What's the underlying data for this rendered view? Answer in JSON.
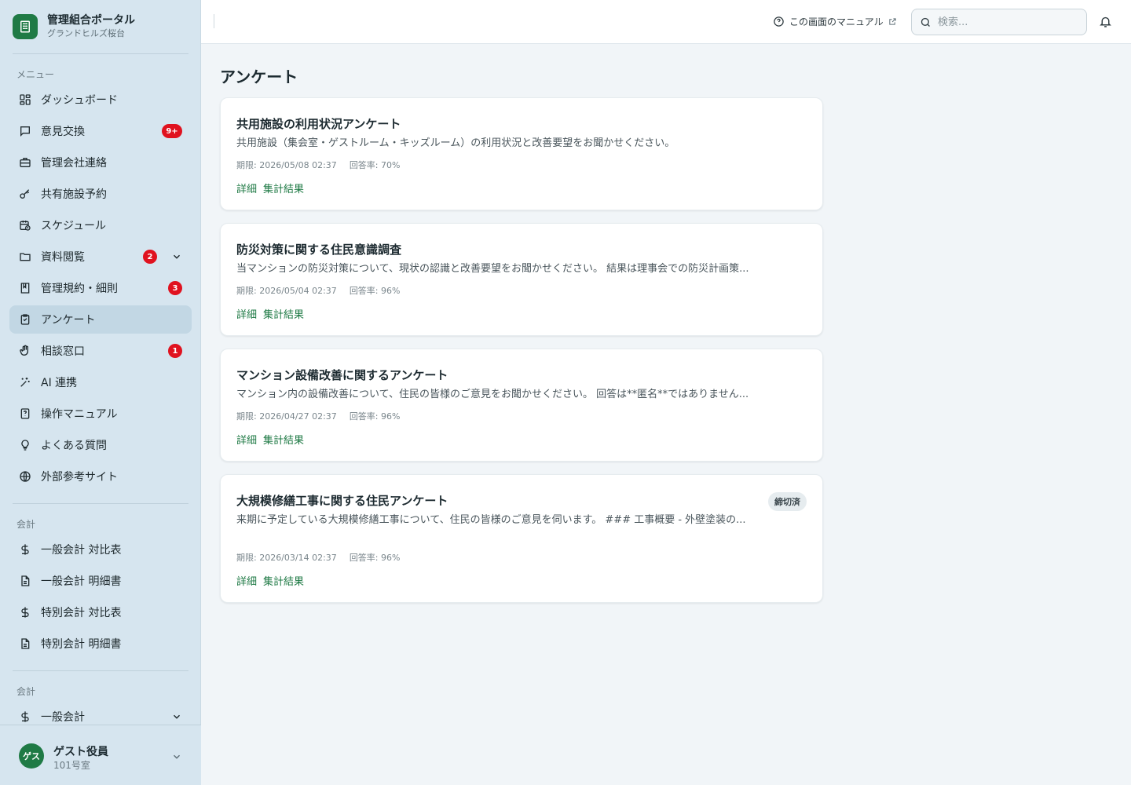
{
  "brand": {
    "title": "管理組合ポータル",
    "subtitle": "グランドヒルズ桜台"
  },
  "sidebar": {
    "menu_label": "メニュー",
    "items": [
      {
        "label": "ダッシュボード",
        "icon": "dashboard-icon"
      },
      {
        "label": "意見交換",
        "icon": "chat-icon",
        "badge": "9+"
      },
      {
        "label": "管理会社連絡",
        "icon": "briefcase-icon"
      },
      {
        "label": "共有施設予約",
        "icon": "key-icon"
      },
      {
        "label": "スケジュール",
        "icon": "calendar-clock-icon"
      },
      {
        "label": "資料閲覧",
        "icon": "folder-icon",
        "badge": "2"
      },
      {
        "label": "管理規約・細則",
        "icon": "book-icon",
        "badge": "3"
      },
      {
        "label": "アンケート",
        "icon": "clipboard-icon",
        "active": true
      },
      {
        "label": "相談窓口",
        "icon": "hand-icon",
        "badge": "1"
      },
      {
        "label": "AI 連携",
        "icon": "sparkle-icon"
      },
      {
        "label": "操作マニュアル",
        "icon": "manual-icon"
      },
      {
        "label": "よくある質問",
        "icon": "lightbulb-icon"
      },
      {
        "label": "外部参考サイト",
        "icon": "globe-icon"
      }
    ],
    "accounting_label": "会計",
    "accounting_items": [
      {
        "label": "一般会計 対比表",
        "icon": "dollar-icon"
      },
      {
        "label": "一般会計 明細書",
        "icon": "document-icon"
      },
      {
        "label": "特別会計 対比表",
        "icon": "dollar-icon"
      },
      {
        "label": "特別会計 明細書",
        "icon": "document-icon"
      }
    ],
    "accounting2_label": "会計",
    "accounting2_items": [
      {
        "label": "一般会計",
        "icon": "dollar-icon"
      }
    ]
  },
  "user": {
    "avatar": "ゲス",
    "name": "ゲスト役員",
    "room": "101号室"
  },
  "header": {
    "manual_label": "この画面のマニュアル",
    "search_placeholder": "検索..."
  },
  "main": {
    "title": "アンケート",
    "cards": [
      {
        "title": "共用施設の利用状況アンケート",
        "description": "共用施設（集会室・ゲストルーム・キッズルーム）の利用状況と改善要望をお聞かせください。",
        "deadline": "期限: 2026/05/08 02:37",
        "rate": "回答率: 70%",
        "detail_label": "詳細",
        "results_label": "集計結果"
      },
      {
        "title": "防災対策に関する住民意識調査",
        "description": "当マンションの防災対策について、現状の認識と改善要望をお聞かせください。 結果は理事会での防災計画策...",
        "deadline": "期限: 2026/05/04 02:37",
        "rate": "回答率: 96%",
        "detail_label": "詳細",
        "results_label": "集計結果"
      },
      {
        "title": "マンション設備改善に関するアンケート",
        "description": "マンション内の設備改善について、住民の皆様のご意見をお聞かせください。 回答は**匿名**ではありません...",
        "deadline": "期限: 2026/04/27 02:37",
        "rate": "回答率: 96%",
        "detail_label": "詳細",
        "results_label": "集計結果"
      },
      {
        "title": "大規模修繕工事に関する住民アンケート",
        "description": "来期に予定している大規模修繕工事について、住民の皆様のご意見を伺います。 ### 工事概要 - 外壁塗装の...",
        "deadline": "期限: 2026/03/14 02:37",
        "rate": "回答率: 96%",
        "detail_label": "詳細",
        "results_label": "集計結果",
        "status": "締切済"
      }
    ]
  },
  "colors": {
    "accent": "#1f7a45",
    "badge": "#e0121f",
    "sidebar_bg": "#d6e5ef"
  }
}
